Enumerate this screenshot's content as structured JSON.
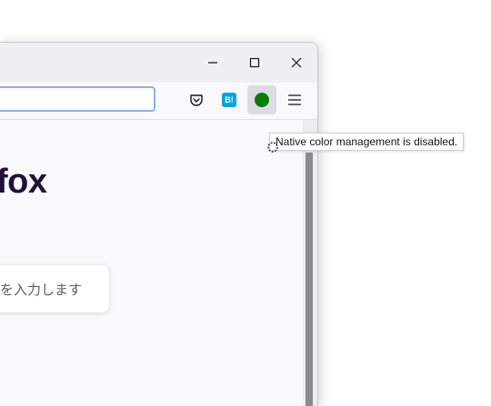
{
  "window": {
    "controls": [
      {
        "name": "minimize",
        "icon": "minimize-icon"
      },
      {
        "name": "maximize",
        "icon": "maximize-icon"
      },
      {
        "name": "close",
        "icon": "close-icon"
      }
    ]
  },
  "toolbar": {
    "url_value": "",
    "buttons": {
      "pocket_icon": "pocket-icon",
      "hatena_label": "B!",
      "extension_color": "#0a7d0a",
      "menu_icon": "hamburger-menu-icon"
    }
  },
  "newtab": {
    "brand_text": "fox",
    "search_placeholder": "を入力します"
  },
  "tooltip": {
    "text": "Native color management is disabled."
  },
  "colors": {
    "brand": "#20123a",
    "urlbar_focus": "#8fb0ea",
    "hatena": "#00a4de"
  }
}
